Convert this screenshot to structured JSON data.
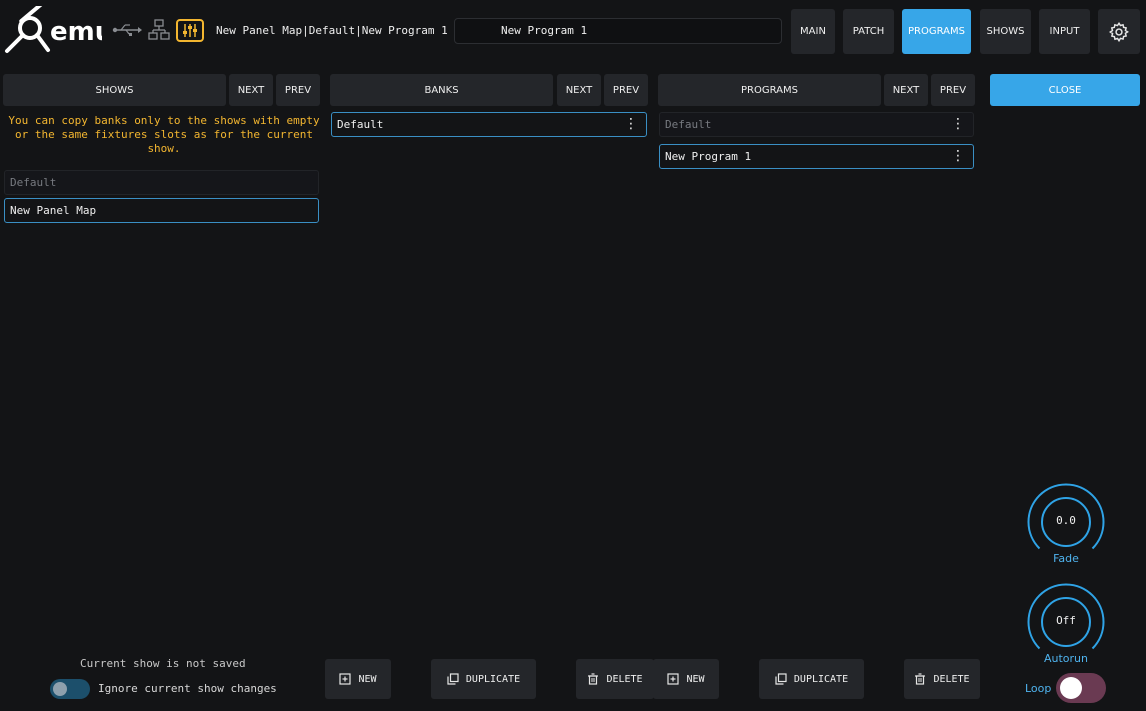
{
  "header": {
    "logo_text": "emu",
    "path": "New Panel Map|Default|New Program 1",
    "program_name": "New Program 1",
    "nav": [
      {
        "label": "MAIN",
        "active": false
      },
      {
        "label": "PATCH",
        "active": false
      },
      {
        "label": "PROGRAMS",
        "active": true
      },
      {
        "label": "SHOWS",
        "active": false
      },
      {
        "label": "INPUT",
        "active": false
      }
    ],
    "icons": [
      "usb-icon",
      "network-icon",
      "mixer-icon",
      "gear-icon"
    ]
  },
  "shows": {
    "title": "SHOWS",
    "next": "NEXT",
    "prev": "PREV",
    "warning": "You can copy banks only to the shows with empty or the same fixtures slots as for the current show.",
    "items": [
      {
        "label": "Default",
        "selected": false
      },
      {
        "label": "New Panel Map",
        "selected": true
      }
    ]
  },
  "banks": {
    "title": "BANKS",
    "next": "NEXT",
    "prev": "PREV",
    "items": [
      {
        "label": "Default",
        "selected": true
      }
    ]
  },
  "programs": {
    "title": "PROGRAMS",
    "next": "NEXT",
    "prev": "PREV",
    "items": [
      {
        "label": "Default",
        "selected": false
      },
      {
        "label": "New Program 1",
        "selected": true
      }
    ]
  },
  "close_label": "CLOSE",
  "footer": {
    "status": "Current show is not saved",
    "ignore_label": "Ignore current show changes",
    "ignore_on": false,
    "banks_actions": {
      "new": "NEW",
      "duplicate": "DUPLICATE",
      "delete": "DELETE"
    },
    "programs_actions": {
      "new": "NEW",
      "duplicate": "DUPLICATE",
      "delete": "DELETE"
    }
  },
  "side": {
    "fade_value": "0.0",
    "fade_label": "Fade",
    "autorun_value": "Off",
    "autorun_label": "Autorun",
    "loop_label": "Loop",
    "loop_on": false
  },
  "colors": {
    "accent": "#37a6e8",
    "warning": "#f3b630",
    "background": "#131416",
    "button": "#24262a"
  }
}
